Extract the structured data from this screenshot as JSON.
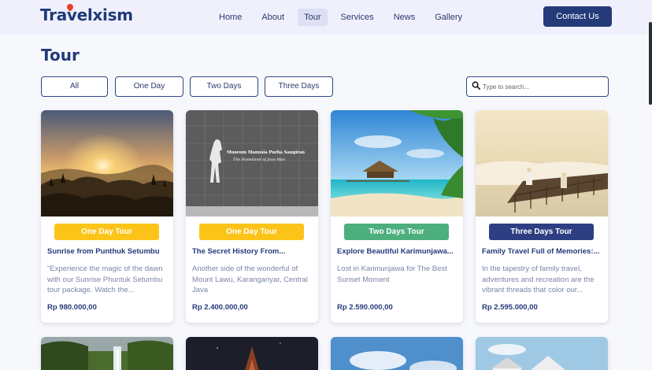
{
  "brand": {
    "name": "Travelxism"
  },
  "nav": {
    "items": [
      {
        "label": "Home",
        "active": false
      },
      {
        "label": "About",
        "active": false
      },
      {
        "label": "Tour",
        "active": true
      },
      {
        "label": "Services",
        "active": false
      },
      {
        "label": "News",
        "active": false
      },
      {
        "label": "Gallery",
        "active": false
      }
    ],
    "contact_label": "Contact Us"
  },
  "page": {
    "title": "Tour"
  },
  "filters": [
    {
      "label": "All"
    },
    {
      "label": "One Day"
    },
    {
      "label": "Two Days"
    },
    {
      "label": "Three Days"
    }
  ],
  "search": {
    "placeholder": "Type to search...",
    "value": ""
  },
  "colors": {
    "primary": "#243b7a",
    "one_day": "#fcc419",
    "two_days": "#4caf7d",
    "three_days": "#2d3f82",
    "header_bg": "#f0f0fc"
  },
  "cards": [
    {
      "badge": "One Day Tour",
      "badge_type": "one_day",
      "title": "Sunrise from Punthuk Setumbu",
      "description": "\"Experience the magic of the dawn with our Sunrise Phuntuk Setumbu tour package. Watch the...",
      "price": "Rp 980.000,00",
      "image": "sunrise-photo"
    },
    {
      "badge": "One Day Tour",
      "badge_type": "one_day",
      "title": "The Secret History From...",
      "description": "Another side of the wonderful of Mount Lawu, Karanganyar, Central Java",
      "price": "Rp 2.400.000,00",
      "image": "museum-photo",
      "image_text_1": "Museum Manusia Purba Sangiran",
      "image_text_2": "The Homeland of Java Man"
    },
    {
      "badge": "Two Days Tour",
      "badge_type": "two_days",
      "title": "Explore Beautiful Karimunjawa...",
      "description": "Lost in Karimunjawa for The Best Sunset Moment",
      "price": "Rp 2.590.000,00",
      "image": "beach-photo"
    },
    {
      "badge": "Three Days Tour",
      "badge_type": "three_days",
      "title": "Family Travel Full of Memories:...",
      "description": "In the tapestry of family travel, adventures and recreation are the vibrant threads that color our...",
      "price": "Rp 2.595.000,00",
      "image": "misty-pier-photo"
    }
  ],
  "cards_row2": [
    {
      "image": "waterfall-photo"
    },
    {
      "image": "temple-night-photo"
    },
    {
      "image": "sky-photo"
    },
    {
      "image": "village-photo"
    }
  ]
}
